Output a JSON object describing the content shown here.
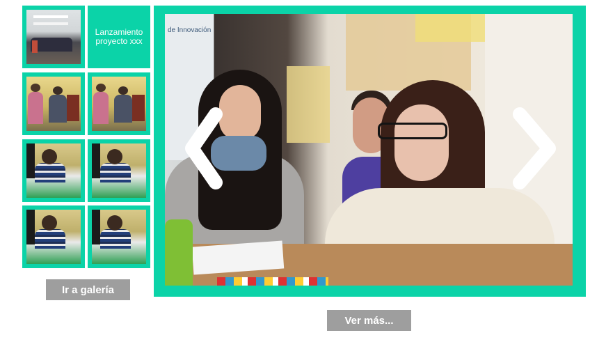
{
  "thumbnails": {
    "caption_tile": {
      "label": "Lanzamiento proyecto xxx"
    }
  },
  "buttons": {
    "gallery_label": "Ir a galería",
    "more_label": "Ver más..."
  },
  "photo": {
    "poster_text": "de Innovación"
  },
  "colors": {
    "accent": "#0bd3a8",
    "button_bg": "#9e9e9e",
    "button_text": "#ffffff"
  },
  "icons": {
    "prev": "chevron-left-icon",
    "next": "chevron-right-icon"
  }
}
